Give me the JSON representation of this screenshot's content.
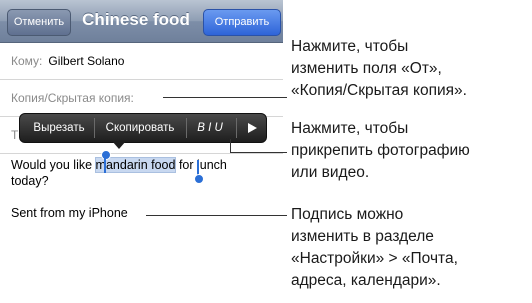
{
  "nav": {
    "cancel_label": "Отменить",
    "title": "Chinese food",
    "send_label": "Отправить"
  },
  "fields": {
    "to_label": "Кому:",
    "to_value": "Gilbert Solano",
    "cc_label": "Копия/Скрытая копия:",
    "subject_partial": "Т"
  },
  "edit_menu": {
    "cut": "Вырезать",
    "copy": "Скопировать",
    "format": "B I U",
    "more_icon": "play-triangle-icon"
  },
  "message": {
    "line1_before": "Would you like ",
    "selected": "mandarin food",
    "line1_after": " for lunch",
    "line2": "today?",
    "signature": "Sent from my iPhone"
  },
  "callouts": {
    "from_fields": [
      "Нажмите, чтобы",
      "изменить поля «От»,",
      "«Копия/Скрытая копия»."
    ],
    "attach": [
      "Нажмите, чтобы",
      "прикрепить фотографию",
      "или видео."
    ],
    "signature": [
      "Подпись можно",
      "изменить в разделе",
      "«Настройки» > «Почта,",
      "адреса, календари»."
    ]
  },
  "colors": {
    "selection_knob": "#2b6fd6",
    "send_button": "#2e64d8"
  }
}
